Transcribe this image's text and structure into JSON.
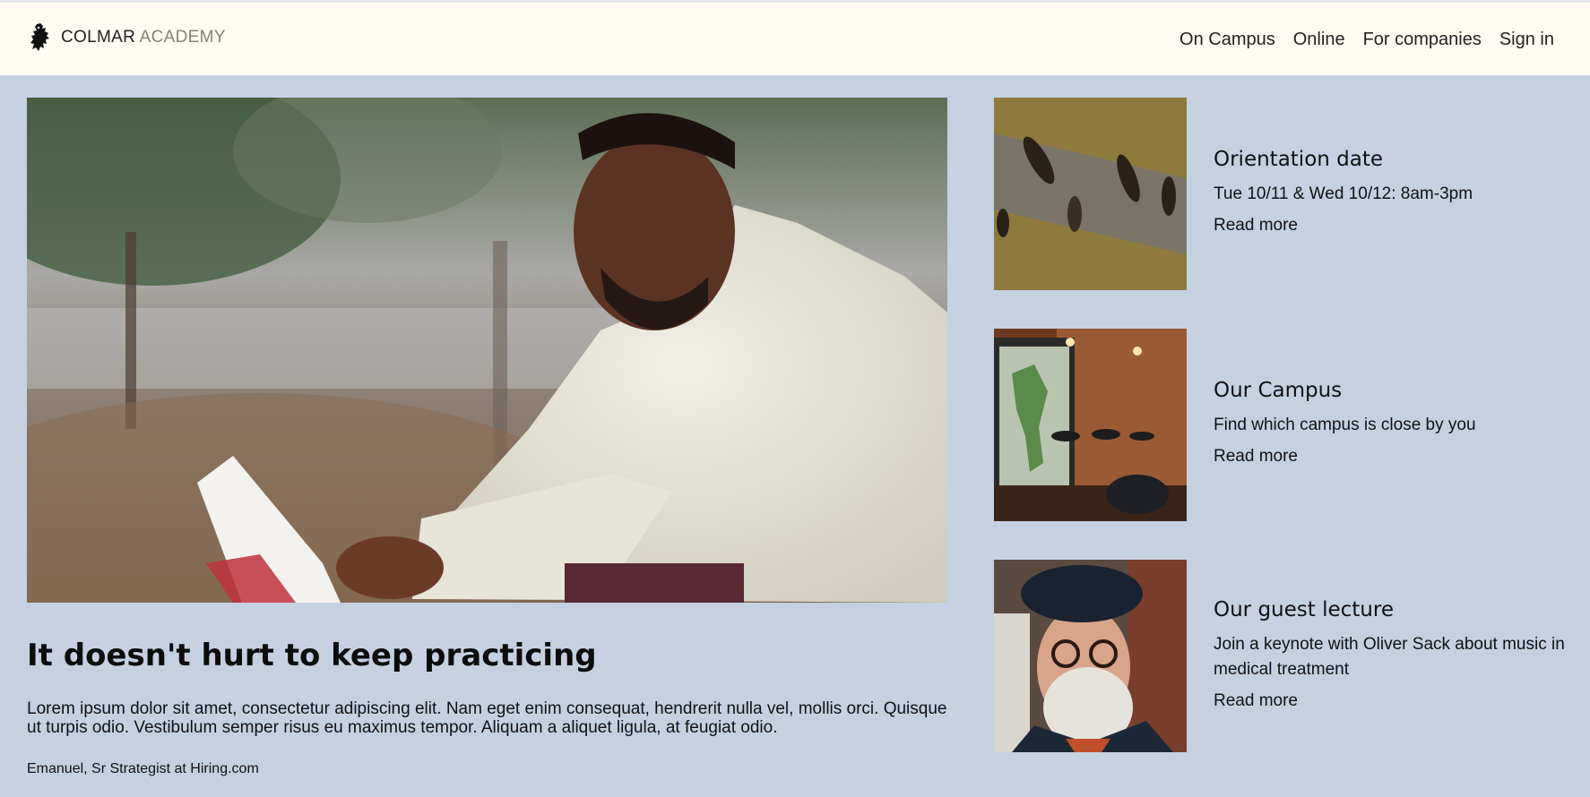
{
  "header": {
    "brand_primary": "COLMAR",
    "brand_secondary": "ACADEMY",
    "logo_icon": "heraldic-lion-icon",
    "nav": [
      {
        "label": "On Campus"
      },
      {
        "label": "Online"
      },
      {
        "label": "For companies"
      },
      {
        "label": "Sign in"
      }
    ]
  },
  "main": {
    "headline": "It doesn't hurt to keep practicing",
    "body": "Lorem ipsum dolor sit amet, consectetur adipiscing elit. Nam eget enim consequat, hendrerit nulla vel, mollis orci. Quisque ut turpis odio. Vestibulum semper risus eu maximus tempor. Aliquam a aliquet ligula, at feugiat odio.",
    "byline": "Emanuel, Sr Strategist at Hiring.com"
  },
  "sidebar": {
    "cards": [
      {
        "title": "Orientation date",
        "text": "Tue 10/11 & Wed 10/12: 8am-3pm",
        "link": "Read more"
      },
      {
        "title": "Our Campus",
        "text": "Find which campus is close by you",
        "link": "Read more"
      },
      {
        "title": "Our guest lecture",
        "text": "Join a keynote with Oliver Sack about music in medical treatment",
        "link": "Read more"
      }
    ]
  },
  "colors": {
    "page_background": "#c5d1e1",
    "nav_background": "#fffcf3",
    "brand_secondary": "#8a8272"
  }
}
